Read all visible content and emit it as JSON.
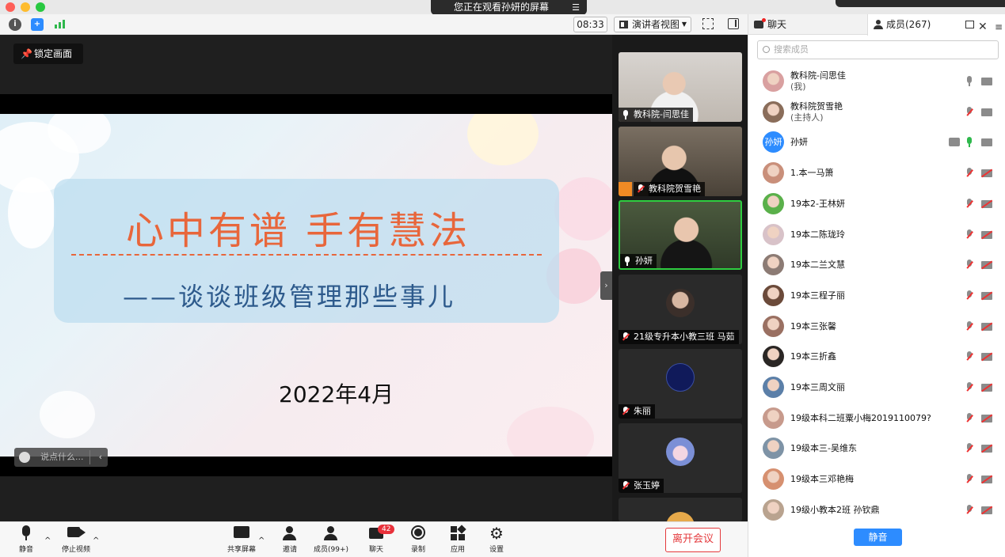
{
  "window": {
    "share_banner": "您正在观看孙妍的屏幕"
  },
  "toolbar": {
    "timer": "08:33",
    "view_label": "演讲者视图"
  },
  "stage": {
    "lock_label": "锁定画面",
    "chat_placeholder": "说点什么..."
  },
  "slide": {
    "title": "心中有谱 手有慧法",
    "subtitle": "——谈谈班级管理那些事儿",
    "date": "2022年4月"
  },
  "thumbnails": [
    {
      "name": "教科院-闫思佳",
      "mic": "on"
    },
    {
      "name": "教科院贺雪艳",
      "mic": "off"
    },
    {
      "name": "孙妍",
      "mic": "on"
    },
    {
      "name": "21级专升本小教三班 马茹",
      "mic": "off"
    },
    {
      "name": "朱丽",
      "mic": "off"
    },
    {
      "name": "张玉婷",
      "mic": "off"
    }
  ],
  "panel": {
    "tab_chat": "聊天",
    "tab_members": "成员(267)",
    "search_placeholder": "搜索成员",
    "mute_all": "静音",
    "members": [
      {
        "name": "教科院-闫思佳",
        "sub": "(我)",
        "mic": "on",
        "cam": "on"
      },
      {
        "name": "教科院贺雪艳",
        "sub": "(主持人)",
        "mic": "off",
        "cam": "on"
      },
      {
        "name": "孙妍",
        "avatar_text": "孙妍",
        "mic": "live",
        "cam": "on",
        "sharing": true
      },
      {
        "name": "1.本一马箫",
        "mic": "off",
        "cam": "off"
      },
      {
        "name": "19本2-王林妍",
        "mic": "off",
        "cam": "off"
      },
      {
        "name": "19本二陈珑玲",
        "mic": "off",
        "cam": "off"
      },
      {
        "name": "19本二兰文慧",
        "mic": "off",
        "cam": "off"
      },
      {
        "name": "19本三程子丽",
        "mic": "off",
        "cam": "off"
      },
      {
        "name": "19本三张馨",
        "mic": "off",
        "cam": "off"
      },
      {
        "name": "19本三折鑫",
        "mic": "off",
        "cam": "off"
      },
      {
        "name": "19本三周文丽",
        "mic": "off",
        "cam": "off"
      },
      {
        "name": "19级本科二班粟小梅2019110079?",
        "mic": "off",
        "cam": "off"
      },
      {
        "name": "19级本三-吴维东",
        "mic": "off",
        "cam": "off"
      },
      {
        "name": "19级本三邓艳梅",
        "mic": "off",
        "cam": "off"
      },
      {
        "name": "19级小教本2班 孙钦鼎",
        "mic": "off",
        "cam": "off"
      }
    ]
  },
  "bottombar": {
    "mute": "静音",
    "stop_video": "停止视频",
    "share_screen": "共享屏幕",
    "invite": "邀请",
    "members": "成员(99+)",
    "chat": "聊天",
    "chat_badge": "42",
    "record": "录制",
    "apps": "应用",
    "settings": "设置",
    "leave": "离开会议"
  },
  "colors": {
    "accent": "#2d8cff",
    "leave": "#e4393c",
    "slide_title": "#e8663b",
    "slide_subtitle": "#2d5a8c"
  }
}
